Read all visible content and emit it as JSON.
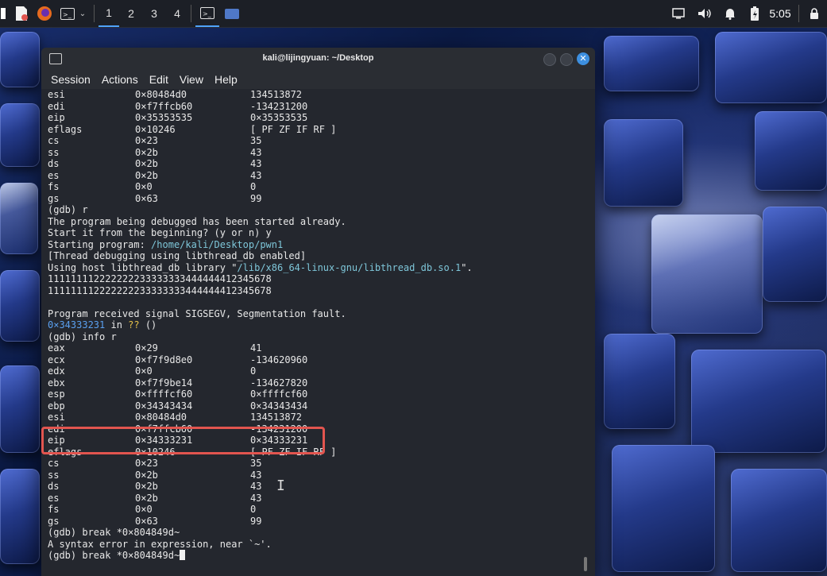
{
  "panel": {
    "workspaces": [
      "1",
      "2",
      "3",
      "4"
    ],
    "clock": "5:05"
  },
  "window": {
    "title": "kali@lijingyuan: ~/Desktop",
    "menu": [
      "Session",
      "Actions",
      "Edit",
      "View",
      "Help"
    ]
  },
  "terminal": {
    "lines": [
      {
        "a": "esi",
        "b": "0×80484d0",
        "c": "134513872"
      },
      {
        "a": "edi",
        "b": "0×f7ffcb60",
        "c": "-134231200"
      },
      {
        "a": "eip",
        "b": "0×35353535",
        "c": "0×35353535"
      },
      {
        "a": "eflags",
        "b": "0×10246",
        "c": "[ PF ZF IF RF ]"
      },
      {
        "a": "cs",
        "b": "0×23",
        "c": "35"
      },
      {
        "a": "ss",
        "b": "0×2b",
        "c": "43"
      },
      {
        "a": "ds",
        "b": "0×2b",
        "c": "43"
      },
      {
        "a": "es",
        "b": "0×2b",
        "c": "43"
      },
      {
        "a": "fs",
        "b": "0×0",
        "c": "0"
      },
      {
        "a": "gs",
        "b": "0×63",
        "c": "99"
      },
      {
        "t": "(gdb) r"
      },
      {
        "t": "The program being debugged has been started already."
      },
      {
        "t": "Start it from the beginning? (y or n) y"
      },
      {
        "pre": "Starting program: ",
        "path": "/home/kali/Desktop/pwn1",
        "post": ""
      },
      {
        "t": "[Thread debugging using libthread_db enabled]"
      },
      {
        "pre": "Using host libthread_db library \"",
        "path": "/lib/x86_64-linux-gnu/libthread_db.so.1",
        "post": "\"."
      },
      {
        "t": "111111112222222233333333444444412345678"
      },
      {
        "t": "111111112222222233333333444444412345678"
      },
      {
        "t": ""
      },
      {
        "t": "Program received signal SIGSEGV, Segmentation fault."
      },
      {
        "addr": "0×34333231",
        "mid": " in ",
        "q": "??",
        "end": " ()"
      },
      {
        "t": "(gdb) info r"
      },
      {
        "a": "eax",
        "b": "0×29",
        "c": "41"
      },
      {
        "a": "ecx",
        "b": "0×f7f9d8e0",
        "c": "-134620960"
      },
      {
        "a": "edx",
        "b": "0×0",
        "c": "0"
      },
      {
        "a": "ebx",
        "b": "0×f7f9be14",
        "c": "-134627820"
      },
      {
        "a": "esp",
        "b": "0×ffffcf60",
        "c": "0×ffffcf60"
      },
      {
        "a": "ebp",
        "b": "0×34343434",
        "c": "0×34343434"
      },
      {
        "a": "esi",
        "b": "0×80484d0",
        "c": "134513872"
      },
      {
        "a": "edi",
        "b": "0×f7ffcb60",
        "c": "-134231200"
      },
      {
        "a": "eip",
        "b": "0×34333231",
        "c": "0×34333231"
      },
      {
        "a": "eflags",
        "b": "0×10246",
        "c": "[ PF ZF IF RF ]"
      },
      {
        "a": "cs",
        "b": "0×23",
        "c": "35"
      },
      {
        "a": "ss",
        "b": "0×2b",
        "c": "43"
      },
      {
        "a": "ds",
        "b": "0×2b",
        "c": "43"
      },
      {
        "a": "es",
        "b": "0×2b",
        "c": "43"
      },
      {
        "a": "fs",
        "b": "0×0",
        "c": "0"
      },
      {
        "a": "gs",
        "b": "0×63",
        "c": "99"
      },
      {
        "t": "(gdb) break *0×804849d~"
      },
      {
        "t": "A syntax error in expression, near `~'."
      },
      {
        "t": "(gdb) break *0×804849d~",
        "cursor": true
      }
    ]
  },
  "colors": {
    "highlight": "#e2554f",
    "accent": "#3d8fe0"
  }
}
